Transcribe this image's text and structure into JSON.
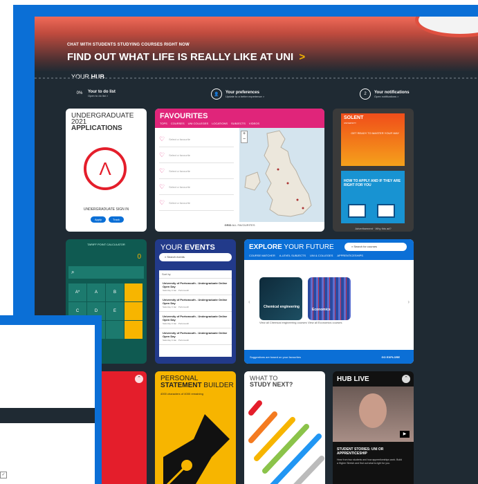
{
  "hero": {
    "small": "CHAT WITH STUDENTS STUDYING COURSES RIGHT NOW",
    "title": "FIND OUT WHAT LIFE IS REALLY LIKE AT UNI",
    "chevron": ">"
  },
  "hub": {
    "label_prefix": "YOUR",
    "label_bold": "HUB"
  },
  "status": [
    {
      "icon": "0%",
      "title": "Your to do list",
      "sub": "Open to do list >"
    },
    {
      "icon": "person-icon",
      "title": "Your preferences",
      "sub": "Update to a better experience >"
    },
    {
      "icon": "2",
      "title": "Your notifications",
      "sub": "Open notifications >"
    }
  ],
  "applications": {
    "title_line1": "UNDERGRADUATE 2021",
    "title_line2": "APPLICATIONS",
    "logo_glyph": "Λ",
    "signin": "UNDERGRADUATE SIGN IN",
    "buttons": [
      "Apply",
      "Track"
    ]
  },
  "favourites": {
    "title": "FAVOURITES",
    "tabs": [
      "TOPS",
      "COURSES",
      "UNI COLLEGES",
      "LOCATIONS",
      "SUBJECTS",
      "VIDEOS"
    ],
    "rows": [
      "Select a favourite",
      "Select a favourite",
      "Select a favourite",
      "Select a favourite",
      "Select a favourite"
    ],
    "footer_bold": "GRID",
    "footer_rest": "ALL FAVOURITES",
    "zoom_in": "+",
    "zoom_out": "−"
  },
  "solent": {
    "brand": "SOLENT",
    "brand_sub": "UNIVERSITY",
    "ad1_text": "GET READY TO MASTER YOUR WAY",
    "ad2_text": "HOW TO APPLY AND IF THEY ARE RIGHT FOR YOU",
    "footer": "Advertisement · Why this ad?"
  },
  "calculator": {
    "title": "TARIFF POINT CALCULATOR",
    "display": "0",
    "keys": [
      "A*",
      "A",
      "B",
      "",
      "C",
      "D",
      "E",
      "",
      "",
      "",
      "",
      "",
      "",
      "",
      "",
      ""
    ]
  },
  "events": {
    "title_prefix": "YOUR",
    "title_bold": "EVENTS",
    "search": "Search events",
    "sort": "Sort by",
    "items": [
      {
        "name": "University of Portsmouth - Undergraduate Online Open Day",
        "date": "Saturday 9 Jan · Portsmouth"
      },
      {
        "name": "University of Portsmouth - Undergraduate Online Open Day",
        "date": "Saturday 9 Jan · Portsmouth"
      },
      {
        "name": "University of Portsmouth - Undergraduate Online Open Day",
        "date": "Saturday 9 Jan · Portsmouth"
      },
      {
        "name": "University of Portsmouth - Undergraduate Online Open Day",
        "date": "Saturday 9 Jan · Portsmouth"
      }
    ]
  },
  "explore": {
    "title_bold": "EXPLORE",
    "title_rest": "YOUR FUTURE",
    "search": "Search for courses",
    "tabs": [
      "COURSE MATCHER",
      "A-LEVEL SUBJECTS",
      "UNI & COLLEGES",
      "APPRENTICESHIPS"
    ],
    "courses": [
      {
        "caption": "Chemical engineering",
        "label": "View all Chemical engineering courses"
      },
      {
        "caption": "Economics",
        "label": "View all Economics courses"
      }
    ],
    "footer_left": "Suggestions are based on your favourites",
    "footer_right": "GO EXPLORE",
    "prev": "‹",
    "next": "›"
  },
  "personal": {
    "title_line1": "PERSONAL",
    "title_bold": "STATEMENT",
    "title_rest": "BUILDER",
    "sub": "4000 characters of 4000 remaining"
  },
  "study": {
    "line1": "WHAT TO",
    "line2": "STUDY NEXT?"
  },
  "live": {
    "title": "HUB LIVE",
    "story": "STUDENT STORIES: UNI OR APPRENTICESHIP",
    "desc": "Hear from two students and how apprenticeships work. Build a Higher Stretch and find out what is right for you."
  },
  "overlay": {
    "check": "✓"
  },
  "colors": {
    "brand_blue": "#0b6fd6",
    "hub_bg": "#1f2a33",
    "pink": "#e0257a",
    "yellow": "#f7b500",
    "red": "#e41e2b",
    "teal": "#0f5a51",
    "navy": "#223a8a"
  }
}
